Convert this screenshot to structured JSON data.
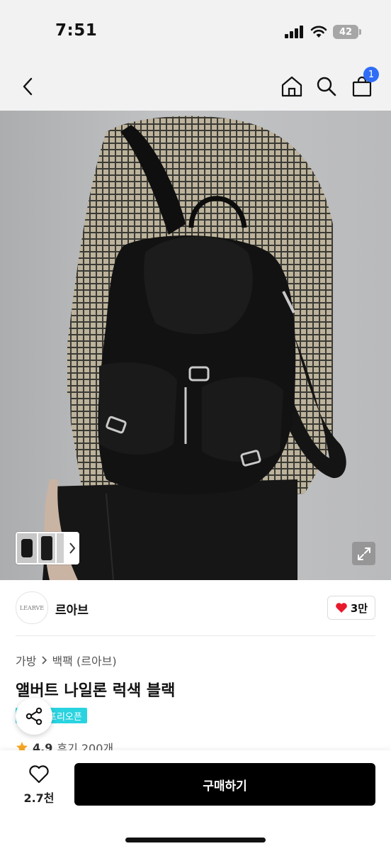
{
  "status": {
    "time": "7:51",
    "battery": "42"
  },
  "nav": {
    "back_icon": "chevron-left-icon",
    "home_icon": "home-icon",
    "search_icon": "search-icon",
    "cart_icon": "shopping-bag-icon",
    "cart_count": "1"
  },
  "hero": {
    "thumb_more_icon": "chevron-right-icon",
    "expand_icon": "expand-icon"
  },
  "brand": {
    "logo_text": "LEARVE",
    "name": "르아브",
    "likes": "3만"
  },
  "product": {
    "breadcrumb": [
      "가방",
      "백팩 (르아브)"
    ],
    "title": "앨버트 나일론 럭색 블랙",
    "tag": "프리오픈",
    "rating": "4.9",
    "reviews": "후기 200개"
  },
  "bottom": {
    "wish_count": "2.7천",
    "buy_label": "구매하기"
  },
  "colors": {
    "accent_badge": "#2ad3e0",
    "cart_badge": "#2f6df6",
    "heart": "#e8192c",
    "star": "#f5a623"
  }
}
